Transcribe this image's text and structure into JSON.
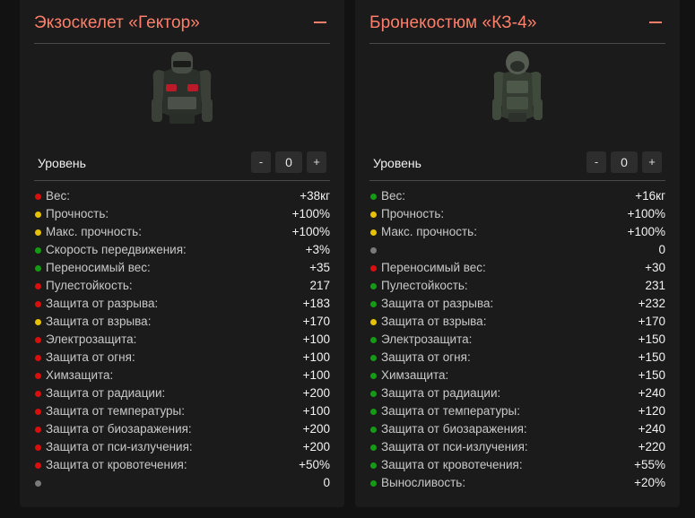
{
  "colors": {
    "red": "#d80f0f",
    "yellow": "#e5c100",
    "green": "#159a15",
    "gray": "#7a7a7a",
    "title": "#ff7f6a"
  },
  "cards": [
    {
      "title": "Экзоскелет «Гектор»",
      "image_icon": "exoskeleton-armor-icon",
      "level_label": "Уровень",
      "level_value": "0",
      "minus_label": "-",
      "plus_label": "+",
      "stats": [
        {
          "label": "Вес:",
          "value": "+38кг",
          "color": "red"
        },
        {
          "label": "Прочность:",
          "value": "+100%",
          "color": "yellow"
        },
        {
          "label": "Макс. прочность:",
          "value": "+100%",
          "color": "yellow"
        },
        {
          "label": "Скорость передвижения:",
          "value": "+3%",
          "color": "green"
        },
        {
          "label": "Переносимый вес:",
          "value": "+35",
          "color": "green"
        },
        {
          "label": "Пулестойкость:",
          "value": "217",
          "color": "red"
        },
        {
          "label": "Защита от разрыва:",
          "value": "+183",
          "color": "red"
        },
        {
          "label": "Защита от взрыва:",
          "value": "+170",
          "color": "yellow"
        },
        {
          "label": "Электрозащита:",
          "value": "+100",
          "color": "red"
        },
        {
          "label": "Защита от огня:",
          "value": "+100",
          "color": "red"
        },
        {
          "label": "Химзащита:",
          "value": "+100",
          "color": "red"
        },
        {
          "label": "Защита от радиации:",
          "value": "+200",
          "color": "red"
        },
        {
          "label": "Защита от температуры:",
          "value": "+100",
          "color": "red"
        },
        {
          "label": "Защита от биозаражения:",
          "value": "+200",
          "color": "red"
        },
        {
          "label": "Защита от пси-излучения:",
          "value": "+200",
          "color": "red"
        },
        {
          "label": "Защита от кровотечения:",
          "value": "+50%",
          "color": "red"
        },
        {
          "label": "",
          "value": "0",
          "color": "gray"
        }
      ]
    },
    {
      "title": "Бронекостюм «КЗ-4»",
      "image_icon": "armored-suit-icon",
      "level_label": "Уровень",
      "level_value": "0",
      "minus_label": "-",
      "plus_label": "+",
      "stats": [
        {
          "label": "Вес:",
          "value": "+16кг",
          "color": "green"
        },
        {
          "label": "Прочность:",
          "value": "+100%",
          "color": "yellow"
        },
        {
          "label": "Макс. прочность:",
          "value": "+100%",
          "color": "yellow"
        },
        {
          "label": "",
          "value": "0",
          "color": "gray"
        },
        {
          "label": "Переносимый вес:",
          "value": "+30",
          "color": "red"
        },
        {
          "label": "Пулестойкость:",
          "value": "231",
          "color": "green"
        },
        {
          "label": "Защита от разрыва:",
          "value": "+232",
          "color": "green"
        },
        {
          "label": "Защита от взрыва:",
          "value": "+170",
          "color": "yellow"
        },
        {
          "label": "Электрозащита:",
          "value": "+150",
          "color": "green"
        },
        {
          "label": "Защита от огня:",
          "value": "+150",
          "color": "green"
        },
        {
          "label": "Химзащита:",
          "value": "+150",
          "color": "green"
        },
        {
          "label": "Защита от радиации:",
          "value": "+240",
          "color": "green"
        },
        {
          "label": "Защита от температуры:",
          "value": "+120",
          "color": "green"
        },
        {
          "label": "Защита от биозаражения:",
          "value": "+240",
          "color": "green"
        },
        {
          "label": "Защита от пси-излучения:",
          "value": "+220",
          "color": "green"
        },
        {
          "label": "Защита от кровотечения:",
          "value": "+55%",
          "color": "green"
        },
        {
          "label": "Выносливость:",
          "value": "+20%",
          "color": "green"
        }
      ]
    }
  ]
}
